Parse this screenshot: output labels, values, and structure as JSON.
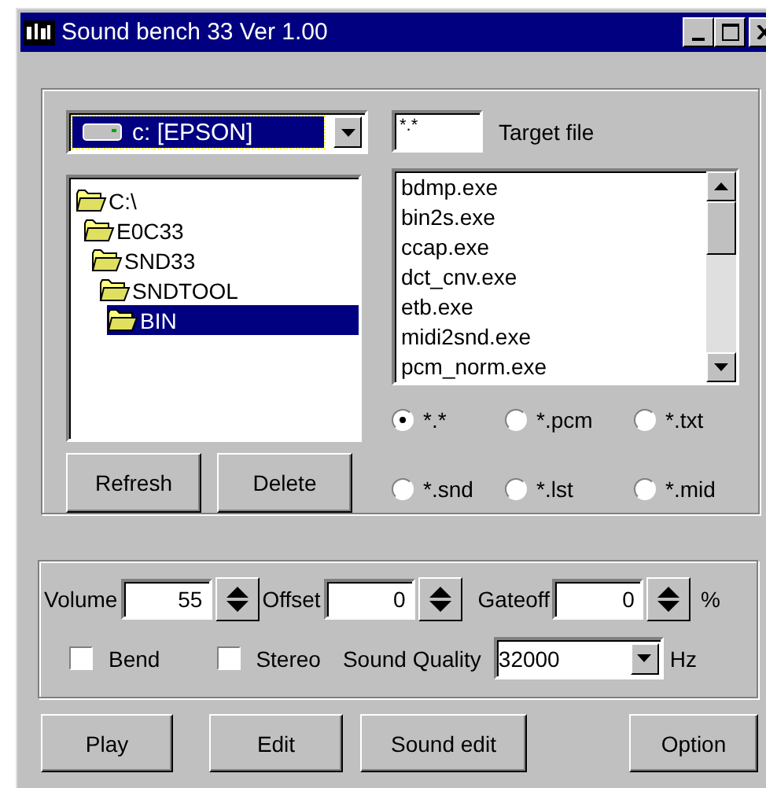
{
  "window": {
    "title": "Sound bench 33 Ver 1.00"
  },
  "drive": {
    "value": "c: [EPSON]"
  },
  "target_file": {
    "value": "*.*",
    "label": "Target file"
  },
  "folders": [
    {
      "name": "C:\\",
      "selected": false,
      "children": [
        {
          "name": "E0C33",
          "selected": false,
          "children": [
            {
              "name": "SND33",
              "selected": false,
              "children": [
                {
                  "name": "SNDTOOL",
                  "selected": false,
                  "children": [
                    {
                      "name": "BIN",
                      "selected": true
                    }
                  ]
                }
              ]
            }
          ]
        }
      ]
    }
  ],
  "files": [
    "bdmp.exe",
    "bin2s.exe",
    "ccap.exe",
    "dct_cnv.exe",
    "etb.exe",
    "midi2snd.exe",
    "pcm_norm.exe"
  ],
  "filters": [
    {
      "label": "*.*",
      "selected": true
    },
    {
      "label": "*.pcm",
      "selected": false
    },
    {
      "label": "*.txt",
      "selected": false
    },
    {
      "label": "*.snd",
      "selected": false
    },
    {
      "label": "*.lst",
      "selected": false
    },
    {
      "label": "*.mid",
      "selected": false
    }
  ],
  "file_buttons": [
    "Refresh",
    "Delete"
  ],
  "volume": {
    "label": "Volume",
    "value": "55"
  },
  "offset": {
    "label": "Offset",
    "value": "0"
  },
  "gateoff": {
    "label": "Gateoff",
    "value": "0",
    "unit": "%"
  },
  "bend": {
    "label": "Bend",
    "checked": false
  },
  "stereo": {
    "label": "Stereo",
    "checked": false
  },
  "sound_quality": {
    "label": "Sound Quality",
    "value": "32000",
    "unit": "Hz"
  },
  "buttons": [
    "Play",
    "Edit",
    "Sound edit",
    "Option"
  ]
}
